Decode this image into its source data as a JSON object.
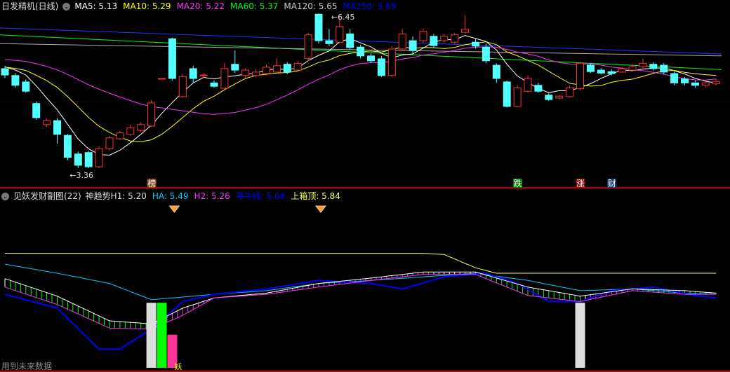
{
  "main": {
    "title": "日发精机(日线)",
    "ma": [
      {
        "label": "MA5: 5.13",
        "color": "#ffffff"
      },
      {
        "label": "MA10: 5.29",
        "color": "#ffff00"
      },
      {
        "label": "MA20: 5.22",
        "color": "#ff33ff"
      },
      {
        "label": "MA60: 5.37",
        "color": "#00ff00"
      },
      {
        "label": "MA120: 5.65",
        "color": "#cccccc"
      },
      {
        "label": "MA250: 5.69",
        "color": "#0000ff"
      }
    ],
    "high_label": "6.45",
    "low_label": "3.36",
    "markers": [
      {
        "text": "榜",
        "color": "#8b4513",
        "index": 14
      },
      {
        "text": "跌",
        "color": "#008000",
        "index": 49
      },
      {
        "text": "涨",
        "color": "#8b0000",
        "index": 55
      },
      {
        "text": "财",
        "color": "#1a3a6a",
        "index": 58
      }
    ]
  },
  "sub": {
    "title": "见妖发财副图(22)",
    "values": [
      {
        "label": "神趋势H1: 5.20",
        "color": "#dddddd"
      },
      {
        "label": "HA: 5.49",
        "color": "#00ccff"
      },
      {
        "label": "H2: 5.26",
        "color": "#ff33ff"
      },
      {
        "label": "寻牛线: 5.08",
        "color": "#0000ff"
      },
      {
        "label": "上箱顶: 5.84",
        "color": "#ffff66"
      }
    ],
    "bar_label": "妖",
    "footer": "用到未来数据"
  },
  "chart_data": {
    "type": "candlestick",
    "up_color": "#ff3333",
    "down_color": "#54ffff",
    "candles": [
      [
        5.39,
        5.26,
        5.45,
        5.2
      ],
      [
        5.25,
        5.05,
        5.3,
        5.0
      ],
      [
        5.12,
        4.93,
        5.17,
        4.9
      ],
      [
        4.68,
        4.39,
        4.72,
        4.35
      ],
      [
        4.25,
        4.33,
        4.37,
        4.2
      ],
      [
        4.33,
        4.05,
        4.38,
        3.86
      ],
      [
        4.03,
        3.58,
        4.06,
        3.52
      ],
      [
        3.65,
        3.42,
        3.7,
        3.36
      ],
      [
        3.68,
        3.39,
        3.72,
        3.36
      ],
      [
        3.39,
        3.76,
        3.8,
        3.36
      ],
      [
        3.76,
        3.98,
        4.02,
        3.72
      ],
      [
        3.96,
        4.08,
        4.12,
        3.93
      ],
      [
        4.05,
        4.18,
        4.25,
        4.02
      ],
      [
        4.13,
        4.25,
        4.3,
        4.1
      ],
      [
        4.22,
        4.69,
        4.75,
        4.2
      ],
      [
        5.19,
        5.19,
        5.19,
        5.19
      ],
      [
        6.0,
        5.19,
        6.02,
        5.15
      ],
      [
        4.82,
        5.23,
        5.28,
        4.8
      ],
      [
        5.39,
        5.19,
        5.45,
        5.1
      ],
      [
        5.26,
        5.26,
        5.3,
        5.2
      ],
      [
        5.1,
        5.03,
        5.15,
        5.0
      ],
      [
        4.99,
        5.39,
        5.5,
        4.95
      ],
      [
        5.48,
        5.36,
        5.76,
        5.3
      ],
      [
        5.25,
        5.36,
        5.4,
        5.2
      ],
      [
        5.25,
        5.32,
        5.38,
        5.22
      ],
      [
        5.29,
        5.42,
        5.48,
        5.25
      ],
      [
        5.32,
        5.45,
        5.6,
        5.3
      ],
      [
        5.48,
        5.32,
        5.52,
        5.28
      ],
      [
        5.36,
        5.5,
        5.55,
        5.33
      ],
      [
        5.6,
        6.08,
        6.12,
        5.55
      ],
      [
        6.5,
        5.96,
        6.52,
        5.9
      ],
      [
        5.96,
        5.9,
        6.2,
        5.85
      ],
      [
        5.93,
        6.25,
        6.45,
        5.9
      ],
      [
        6.1,
        5.82,
        6.2,
        5.78
      ],
      [
        5.83,
        5.65,
        5.88,
        5.6
      ],
      [
        5.65,
        5.55,
        5.7,
        5.5
      ],
      [
        5.59,
        5.25,
        5.65,
        5.22
      ],
      [
        5.25,
        5.79,
        5.85,
        5.22
      ],
      [
        5.79,
        6.1,
        6.2,
        5.75
      ],
      [
        5.96,
        5.76,
        6.05,
        5.7
      ],
      [
        5.96,
        6.15,
        6.2,
        5.92
      ],
      [
        6.05,
        5.86,
        6.1,
        5.82
      ],
      [
        5.96,
        6.05,
        6.1,
        5.92
      ],
      [
        5.93,
        6.08,
        6.12,
        5.9
      ],
      [
        6.13,
        6.19,
        6.48,
        6.1
      ],
      [
        5.93,
        5.85,
        6.0,
        5.8
      ],
      [
        5.83,
        5.55,
        5.9,
        5.5
      ],
      [
        5.46,
        5.19,
        5.5,
        5.1
      ],
      [
        5.12,
        4.62,
        5.15,
        4.6
      ],
      [
        4.62,
        5.0,
        5.05,
        4.6
      ],
      [
        4.93,
        5.19,
        5.25,
        4.9
      ],
      [
        5.05,
        4.93,
        5.1,
        4.9
      ],
      [
        4.85,
        4.76,
        4.9,
        4.73
      ],
      [
        4.79,
        4.83,
        4.86,
        4.76
      ],
      [
        4.82,
        5.0,
        5.05,
        4.8
      ],
      [
        4.98,
        5.5,
        5.52,
        4.95
      ],
      [
        5.46,
        5.33,
        5.5,
        5.3
      ],
      [
        5.36,
        5.3,
        5.4,
        5.27
      ],
      [
        5.33,
        5.29,
        5.38,
        5.25
      ],
      [
        5.32,
        5.39,
        5.42,
        5.3
      ],
      [
        5.36,
        5.43,
        5.48,
        5.33
      ],
      [
        5.43,
        5.5,
        5.6,
        5.4
      ],
      [
        5.48,
        5.39,
        5.52,
        5.35
      ],
      [
        5.46,
        5.32,
        5.5,
        5.28
      ],
      [
        5.29,
        5.1,
        5.33,
        5.05
      ],
      [
        5.18,
        5.1,
        5.22,
        5.05
      ],
      [
        5.1,
        5.05,
        5.15,
        5.0
      ],
      [
        5.05,
        5.1,
        5.15,
        5.0
      ],
      [
        5.08,
        5.13,
        5.18,
        5.05
      ]
    ],
    "long_ma": [
      {
        "name": "MA60",
        "color": "#00ff00",
        "start": 6.08,
        "end": 5.37
      },
      {
        "name": "MA120",
        "color": "#aaaaaa",
        "start": 5.9,
        "end": 5.65
      },
      {
        "name": "MA250",
        "color": "#2233ff",
        "start": 6.22,
        "end": 5.69
      }
    ],
    "sub_series": [
      {
        "name": "上箱顶",
        "color": "#ffff66",
        "points": [
          [
            0,
            6.17
          ],
          [
            40,
            6.17
          ],
          [
            42,
            6.15
          ],
          [
            45,
            5.93
          ],
          [
            47,
            5.84
          ],
          [
            68,
            5.84
          ]
        ]
      },
      {
        "name": "HA",
        "color": "#00ccff",
        "points": [
          [
            0,
            5.99
          ],
          [
            5,
            5.84
          ],
          [
            10,
            5.67
          ],
          [
            14,
            5.4
          ],
          [
            20,
            5.49
          ],
          [
            25,
            5.55
          ],
          [
            30,
            5.67
          ],
          [
            35,
            5.72
          ],
          [
            40,
            5.78
          ],
          [
            45,
            5.84
          ],
          [
            50,
            5.72
          ],
          [
            55,
            5.55
          ],
          [
            60,
            5.58
          ],
          [
            65,
            5.51
          ],
          [
            68,
            5.49
          ]
        ]
      },
      {
        "name": "寻牛线",
        "color": "#0000ff",
        "points": [
          [
            0,
            5.49
          ],
          [
            5,
            5.26
          ],
          [
            9,
            4.58
          ],
          [
            11,
            4.58
          ],
          [
            14,
            4.91
          ],
          [
            17,
            5.37
          ],
          [
            20,
            5.49
          ],
          [
            25,
            5.58
          ],
          [
            30,
            5.72
          ],
          [
            35,
            5.67
          ],
          [
            38,
            5.58
          ],
          [
            42,
            5.78
          ],
          [
            46,
            5.84
          ],
          [
            49,
            5.67
          ],
          [
            52,
            5.37
          ],
          [
            55,
            5.37
          ],
          [
            58,
            5.55
          ],
          [
            62,
            5.61
          ],
          [
            66,
            5.47
          ],
          [
            68,
            5.43
          ]
        ]
      },
      {
        "name": "H1",
        "color": "#ffffff",
        "points": [
          [
            0,
            5.75
          ],
          [
            5,
            5.46
          ],
          [
            10,
            5.05
          ],
          [
            14,
            5.0
          ],
          [
            17,
            5.26
          ],
          [
            20,
            5.43
          ],
          [
            25,
            5.51
          ],
          [
            30,
            5.67
          ],
          [
            35,
            5.76
          ],
          [
            40,
            5.86
          ],
          [
            45,
            5.86
          ],
          [
            50,
            5.61
          ],
          [
            55,
            5.46
          ],
          [
            60,
            5.58
          ],
          [
            65,
            5.55
          ],
          [
            68,
            5.51
          ]
        ]
      },
      {
        "name": "H2",
        "color": "#ff33ff",
        "points": [
          [
            0,
            5.61
          ],
          [
            5,
            5.32
          ],
          [
            10,
            4.93
          ],
          [
            14,
            4.91
          ],
          [
            17,
            5.14
          ],
          [
            20,
            5.43
          ],
          [
            25,
            5.49
          ],
          [
            30,
            5.61
          ],
          [
            35,
            5.72
          ],
          [
            40,
            5.82
          ],
          [
            45,
            5.82
          ],
          [
            50,
            5.47
          ],
          [
            55,
            5.37
          ],
          [
            60,
            5.55
          ],
          [
            65,
            5.49
          ],
          [
            68,
            5.49
          ]
        ]
      }
    ],
    "signal_bars": [
      {
        "index": 14,
        "top": 5.35,
        "color": "#dddddd"
      },
      {
        "index": 15,
        "top": 5.35,
        "color": "#00ff00"
      },
      {
        "index": 16,
        "top": 4.82,
        "color": "#ff3399"
      },
      {
        "index": 55,
        "top": 5.35,
        "color": "#dddddd"
      }
    ],
    "diamonds": [
      16,
      30
    ]
  }
}
